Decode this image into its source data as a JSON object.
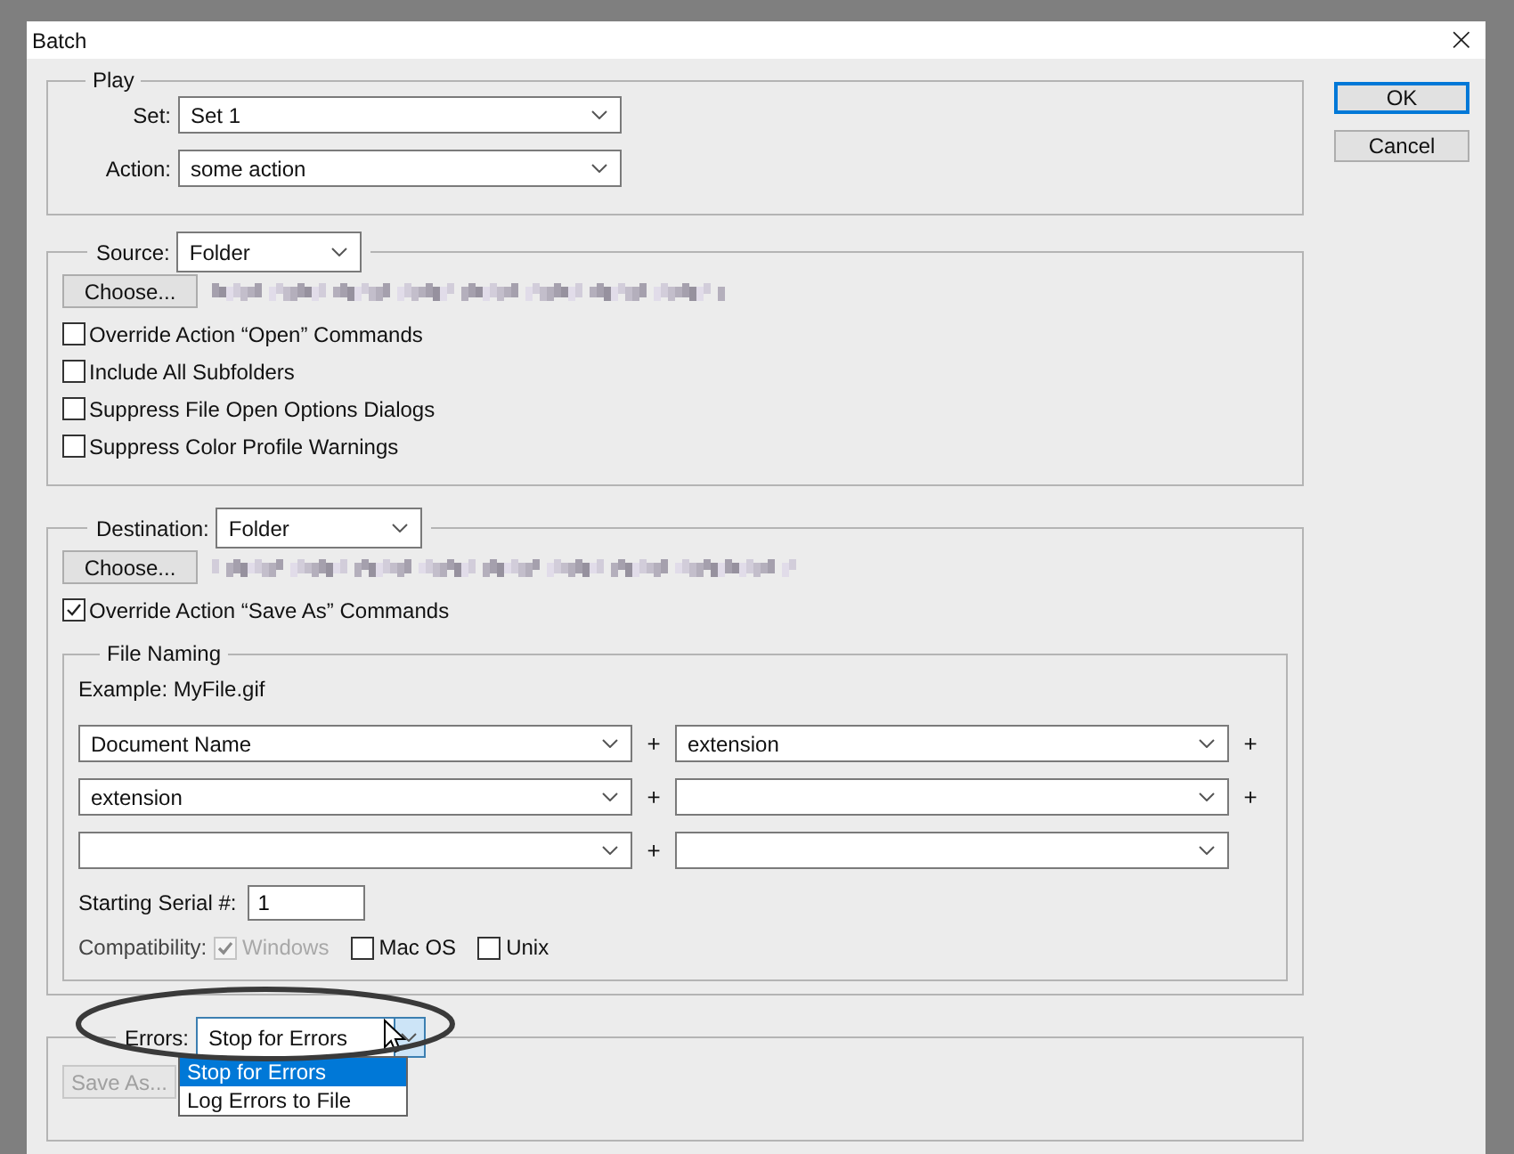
{
  "window": {
    "title": "Batch",
    "close": "×"
  },
  "buttons": [
    {
      "label": "OK",
      "default": true
    },
    {
      "label": "Cancel",
      "default": false
    }
  ],
  "play": {
    "title": "Play",
    "set": {
      "label": "Set:",
      "value": "Set 1"
    },
    "action": {
      "label": "Action:",
      "value": "some action"
    }
  },
  "source": {
    "label": "Source:",
    "value": "Folder",
    "choose": "Choose...",
    "options": [
      {
        "label": "Override Action “Open” Commands",
        "checked": false
      },
      {
        "label": "Include All Subfolders",
        "checked": false
      },
      {
        "label": "Suppress File Open Options Dialogs",
        "checked": false
      },
      {
        "label": "Suppress Color Profile Warnings",
        "checked": false
      }
    ]
  },
  "destination": {
    "label": "Destination:",
    "value": "Folder",
    "choose": "Choose...",
    "override": {
      "label": "Override Action “Save As” Commands",
      "checked": true
    },
    "file_naming": {
      "title": "File Naming",
      "example": "Example: MyFile.gif",
      "rows": [
        {
          "cells": [
            {
              "value": "Document Name"
            },
            {
              "value": "extension"
            }
          ],
          "joins": [
            "+",
            "+"
          ]
        },
        {
          "cells": [
            {
              "value": "extension"
            },
            {}
          ],
          "joins": [
            "+",
            "+"
          ]
        },
        {
          "cells": [
            {},
            {}
          ],
          "joins": [
            "+"
          ]
        }
      ],
      "serial": {
        "label": "Starting Serial #:",
        "value": "1"
      },
      "compatibility": {
        "label": "Compatibility:",
        "options": [
          {
            "label": "Windows",
            "checked": true,
            "disabled": true
          },
          {
            "label": "Mac OS",
            "checked": false,
            "disabled": false
          },
          {
            "label": "Unix",
            "checked": false,
            "disabled": false
          }
        ]
      }
    }
  },
  "errors": {
    "label": "Errors:",
    "value": "Stop for Errors",
    "expanded": true,
    "options": [
      {
        "label": "Stop for Errors",
        "selected": true
      },
      {
        "label": "Log Errors to File",
        "selected": false
      }
    ],
    "save_as": {
      "label": "Save As...",
      "disabled": true
    }
  }
}
